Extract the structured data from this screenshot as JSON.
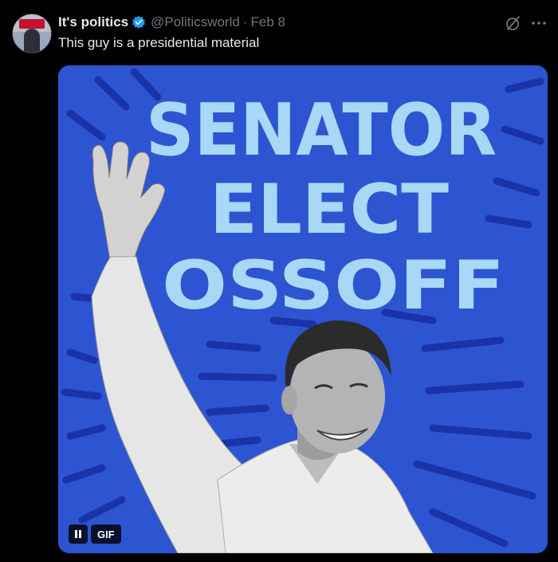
{
  "tweet": {
    "author_name": "It's politics",
    "handle": "@Politicsworld",
    "separator": "·",
    "date": "Feb 8",
    "text": "This guy is a presidential material",
    "verified": true,
    "accent_color": "#1d9bf0"
  },
  "media": {
    "type": "gif",
    "headline_lines": [
      "SENATOR",
      "ELECT",
      "OSSOFF"
    ],
    "background_color": "#2d55d1",
    "lettering_color": "#a8d8f5",
    "gif_badge": "GIF",
    "paused": false
  },
  "icons": {
    "verified": "verified-badge-icon",
    "grok": "grok-icon",
    "more": "more-options-icon",
    "pause": "pause-icon"
  }
}
